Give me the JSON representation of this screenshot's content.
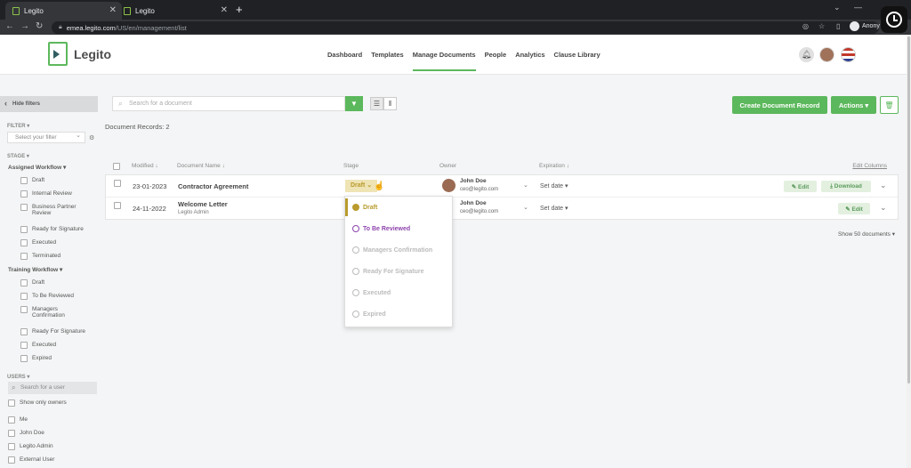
{
  "browser": {
    "tabs": [
      {
        "title": "Legito"
      },
      {
        "title": "Legito"
      }
    ],
    "url_host": "emea.legito.com",
    "url_path": "/US/en/management/list",
    "profile": "Anony"
  },
  "app": {
    "logo_text": "Legito",
    "nav": [
      "Dashboard",
      "Templates",
      "Manage Documents",
      "People",
      "Analytics",
      "Clause Library"
    ],
    "active_nav": "Manage Documents"
  },
  "sidebar": {
    "hide_filters": "Hide filters",
    "filter_title": "FILTER",
    "filter_placeholder": "Select your filter",
    "stage_title": "STAGE",
    "assigned_workflow": "Assigned Workflow",
    "assigned_items": [
      "Draft",
      "Internal Review",
      "Business Partner Review",
      "Ready for Signature",
      "Executed",
      "Terminated"
    ],
    "training_workflow": "Training Workflow",
    "training_items": [
      "Draft",
      "To Be Reviewed",
      "Managers Confirmation",
      "Ready For Signature",
      "Executed",
      "Expired"
    ],
    "users_title": "USERS",
    "users_search_placeholder": "Search for a user",
    "show_only_owners": "Show only owners",
    "users": [
      "Me",
      "John Doe",
      "Legito Admin",
      "External User"
    ]
  },
  "toolbar": {
    "search_placeholder": "Search for a document",
    "create_label": "Create Document Record",
    "actions_label": "Actions ▾"
  },
  "records_label": "Document Records: 2",
  "table": {
    "headers": {
      "modified": "Modified ↓",
      "name": "Document Name ↓",
      "stage": "Stage",
      "owner": "Owner",
      "expiration": "Expiration ↓",
      "edit_columns": "Edit Columns"
    },
    "rows": [
      {
        "date": "23-01-2023",
        "name": "Contractor Agreement",
        "subtitle": "",
        "stage": "Draft ⌄",
        "owner_name": "John Doe",
        "owner_email": "ceo@legito.com",
        "expiration": "Set date ▾",
        "edit": "✎ Edit",
        "download": "⤓ Download"
      },
      {
        "date": "24-11-2022",
        "name": "Welcome Letter",
        "subtitle": "Legito Admin",
        "stage": "",
        "owner_name": "John Doe",
        "owner_email": "ceo@legito.com",
        "expiration": "Set date ▾",
        "edit": "✎ Edit",
        "download": ""
      }
    ]
  },
  "stage_dropdown": [
    "Draft",
    "To Be Reviewed",
    "Managers Confirmation",
    "Ready For Signature",
    "Executed",
    "Expired"
  ],
  "show_per_page": "Show 50 documents ▾",
  "colors": {
    "accent": "#5cb85c",
    "draft": "#b89b2c",
    "review": "#8e44ad"
  }
}
